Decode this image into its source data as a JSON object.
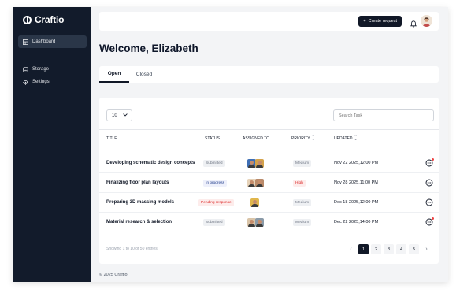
{
  "brand": {
    "name": "Craftio"
  },
  "sidebar": {
    "items": [
      {
        "label": "Dashboard",
        "icon": "dashboard-icon",
        "active": true
      },
      {
        "label": "Storage",
        "icon": "database-icon",
        "active": false
      },
      {
        "label": "Settings",
        "icon": "gear-icon",
        "active": false
      }
    ]
  },
  "topbar": {
    "create_label": "Create request"
  },
  "welcome": "Welcome, Elizabeth",
  "tabs": [
    {
      "label": "Open"
    },
    {
      "label": "Closed"
    }
  ],
  "controls": {
    "per_page": "10",
    "search_placeholder": "Search Task"
  },
  "table": {
    "headers": {
      "title": "TITLE",
      "status": "STATUS",
      "assigned": "ASSIGNED TO",
      "priority": "PRIORITY",
      "updated": "UPDATED"
    },
    "rows": [
      {
        "title": "Developing schematic design concepts",
        "status": "Submitted",
        "priority": "Medium",
        "updated": "Nov 22 2025,12:00 PM"
      },
      {
        "title": "Finalizing floor plan layouts",
        "status": "In progress",
        "priority": "High",
        "updated": "Nov 28 2025,11:00 PM"
      },
      {
        "title": "Preparing 3D massing models",
        "status": "Pending response",
        "priority": "Medium",
        "updated": "Dec 18 2025,12:00 PM"
      },
      {
        "title": "Material research & selection",
        "status": "Submitted",
        "priority": "Medium",
        "updated": "Dec 22 2025,14:00 PM"
      }
    ]
  },
  "pagination": {
    "showing": "Showing 1 to 10 of 50 entries",
    "prev": "‹",
    "pages": [
      "1",
      "2",
      "3",
      "4",
      "5"
    ],
    "next": "›"
  },
  "footer": "© 2025 Craftio",
  "colors": {
    "sidebar": "#121b2b",
    "accent": "#111827",
    "danger": "#dc2626"
  }
}
